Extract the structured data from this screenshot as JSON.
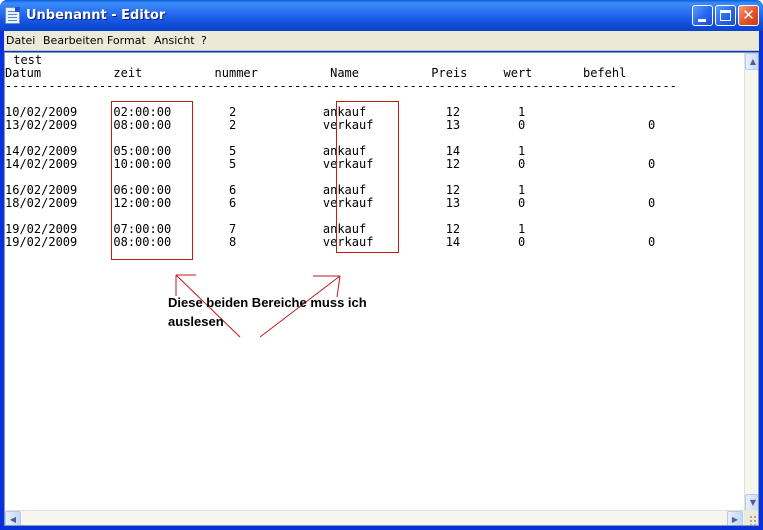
{
  "window": {
    "title": "Unbenannt - Editor"
  },
  "menu": [
    "Datei",
    "Bearbeiten",
    "Format",
    "Ansicht",
    "?"
  ],
  "editor_lines": [
    " test",
    "Datum          zeit          nummer          Name          Preis     wert       befehl",
    "---------------------------------------------------------------------------------------------",
    "",
    "10/02/2009     02:00:00        2            ankauf           12        1",
    "13/02/2009     08:00:00        2            verkauf          13        0                 0",
    "",
    "14/02/2009     05:00:00        5            ankauf           14        1",
    "14/02/2009     10:00:00        5            verkauf          12        0                 0",
    "",
    "16/02/2009     06:00:00        6            ankauf           12        1",
    "18/02/2009     12:00:00        6            verkauf          13        0                 0",
    "",
    "19/02/2009     07:00:00        7            ankauf           12        1",
    "19/02/2009     08:00:00        8            verkauf          14        0                 0"
  ],
  "annotation": {
    "line1": "Diese beiden Bereiche muss ich",
    "line2": "auslesen"
  },
  "colors": {
    "annotation_red": "#c21a1a"
  }
}
